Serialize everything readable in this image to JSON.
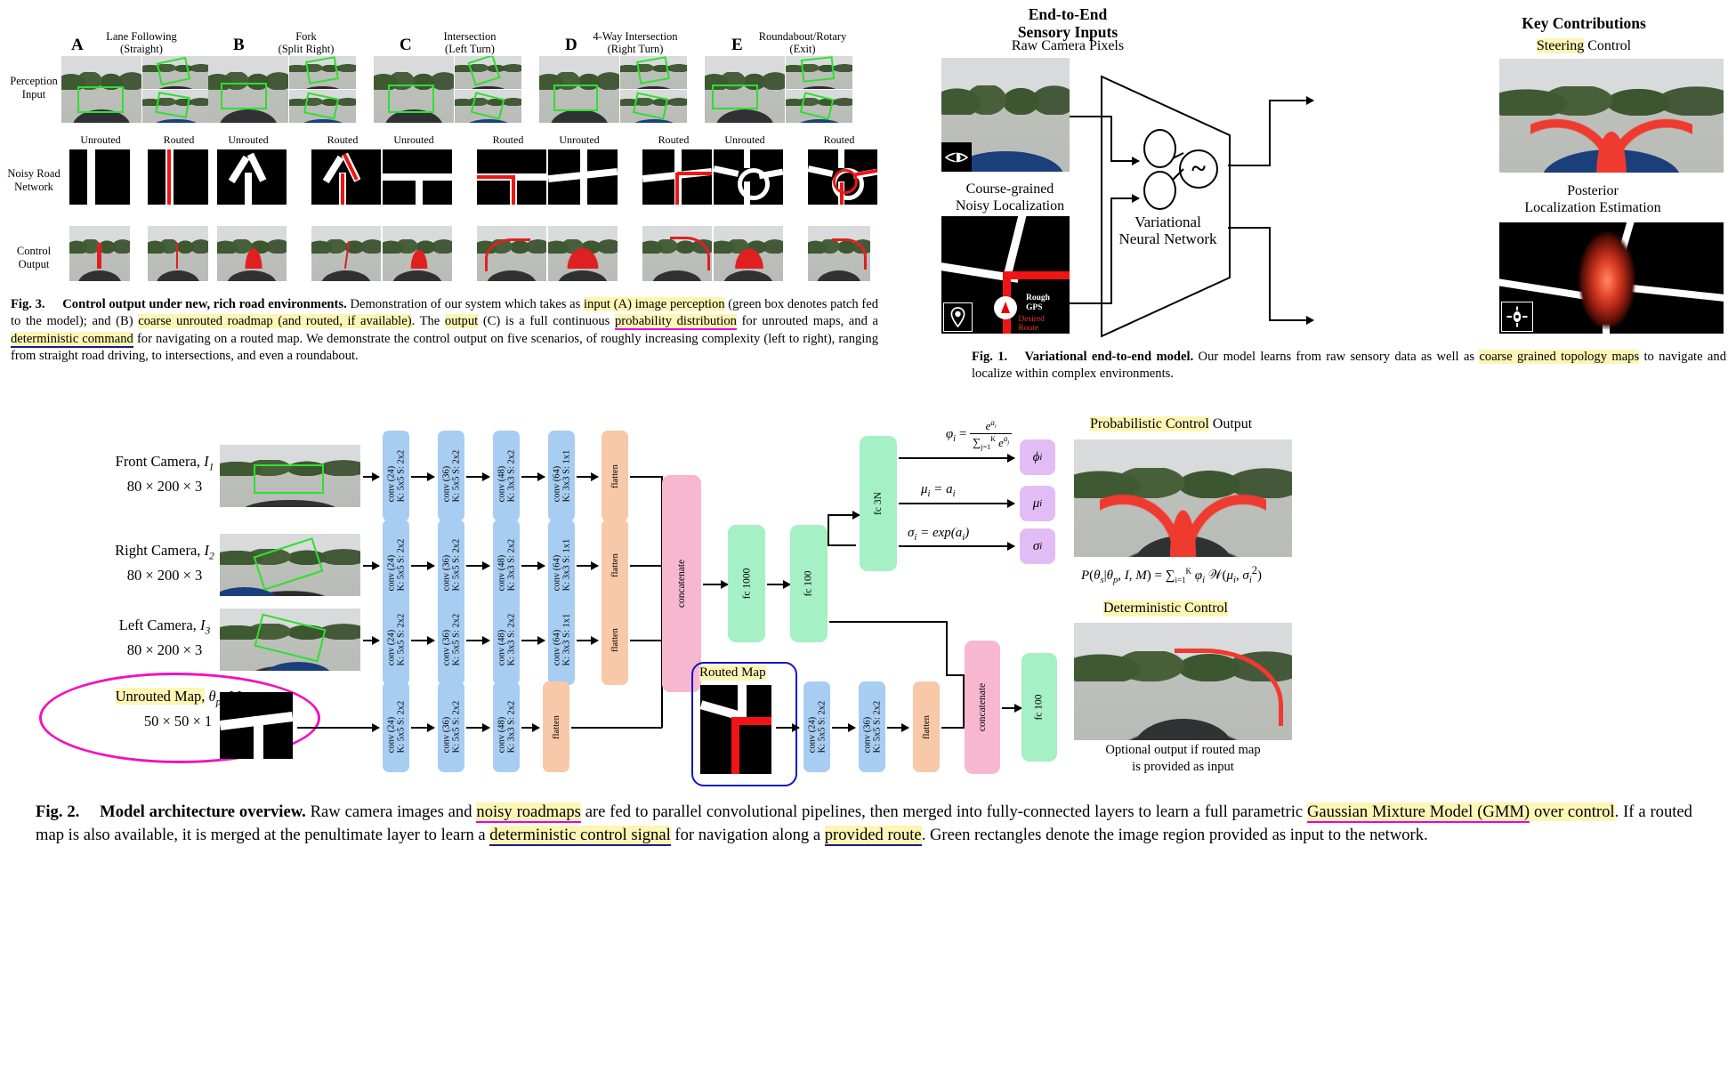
{
  "fig3": {
    "row_labels": [
      "Perception\nInput",
      "Noisy Road\nNetwork",
      "Control\nOutput"
    ],
    "row_label_1a": "Perception",
    "row_label_1b": "Input",
    "row_label_2a": "Noisy Road",
    "row_label_2b": "Network",
    "row_label_3a": "Control",
    "row_label_3b": "Output",
    "scenarios": [
      {
        "letter": "A",
        "title": "Lane Following",
        "subtitle": "(Straight)"
      },
      {
        "letter": "B",
        "title": "Fork",
        "subtitle": "(Split Right)"
      },
      {
        "letter": "C",
        "title": "Intersection",
        "subtitle": "(Left Turn)"
      },
      {
        "letter": "D",
        "title": "4-Way Intersection",
        "subtitle": "(Right Turn)"
      },
      {
        "letter": "E",
        "title": "Roundabout/Rotary",
        "subtitle": "(Exit)"
      }
    ],
    "map_col_labels": [
      "Unrouted",
      "Routed"
    ],
    "caption": {
      "figno": "Fig. 3.",
      "title": "Control output under new, rich road environments.",
      "t1": " Demonstration of our system which takes as ",
      "h1": "input (A) image perception",
      "t2": " (green box denotes patch fed to the model); and (B) ",
      "h2": "coarse unrouted roadmap (and routed, if available)",
      "t3": ". The ",
      "h3": "output",
      "t4": " (C) is a full continuous ",
      "h4": "probability distribution",
      "t5": " for unrouted maps, and a ",
      "h5": "deterministic command",
      "t6": " for navigating on a routed map. We demonstrate the control output on five scenarios, of roughly increasing complexity (left to right), ranging from straight road driving, to intersections, and even a roundabout."
    }
  },
  "fig1": {
    "header_left_1": "End-to-End",
    "header_left_2": "Sensory Inputs",
    "header_right": "Key Contributions",
    "input_1": "Raw Camera Pixels",
    "input_2a": "Course-grained",
    "input_2b": "Noisy Localization",
    "output_1_hl": "Steering",
    "output_1_rest": " Control",
    "output_2a": "Posterior",
    "output_2b": "Localization Estimation",
    "network_1": "Variational",
    "network_2": "Neural Network",
    "network_symbol": "~",
    "map_annot_1a": "Rough",
    "map_annot_1b": "GPS",
    "map_annot_2a": "Desired",
    "map_annot_2b": "Route",
    "icon_eye": "eye-icon",
    "icon_pin": "location-pin-icon",
    "icon_target": "crosshair-target-icon",
    "caption": {
      "figno": "Fig. 1.",
      "title": "Variational end-to-end model.",
      "t1": " Our model learns from raw sensory data as well as ",
      "h1": "coarse grained topology maps",
      "t2": " to navigate and localize within complex environments."
    }
  },
  "fig2": {
    "cameras": [
      {
        "name": "Front Camera,",
        "sym": "I",
        "idx": "1",
        "dims": "80 × 200 × 3"
      },
      {
        "name": "Right Camera,",
        "sym": "I",
        "idx": "2",
        "dims": "80 × 200 × 3"
      },
      {
        "name": "Left Camera,",
        "sym": "I",
        "idx": "3",
        "dims": "80 × 200 × 3"
      }
    ],
    "map_input": {
      "label": "Unrouted Map,",
      "sym": "θ",
      "sub": "p",
      "sym2": ", M",
      "dims": "50 × 50 × 1"
    },
    "conv_camera": [
      {
        "l1": "conv (24)",
        "l2": "K: 5x5 S: 2x2"
      },
      {
        "l1": "conv (36)",
        "l2": "K: 5x5 S: 2x2"
      },
      {
        "l1": "conv (48)",
        "l2": "K: 3x3 S: 2x2"
      },
      {
        "l1": "conv (64)",
        "l2": "K: 3x3 S: 1x1"
      }
    ],
    "conv_map": [
      {
        "l1": "conv (24)",
        "l2": "K: 5x5 S: 2x2"
      },
      {
        "l1": "conv (36)",
        "l2": "K: 5x5 S: 2x2"
      },
      {
        "l1": "conv (48)",
        "l2": "K: 3x3 S: 2x2"
      }
    ],
    "conv_routed": [
      {
        "l1": "conv (24)",
        "l2": "K: 5x5 S: 2x2"
      },
      {
        "l1": "conv (36)",
        "l2": "K: 5x5 S: 2x2"
      }
    ],
    "flatten_label": "flatten",
    "concat_label": "concatenate",
    "fc1000_label": "fc 1000",
    "fc100_label": "fc 100",
    "fc3N_label": "fc 3N",
    "fc100b_label": "fc 100",
    "routed_map_label": "Routed Map",
    "equations": [
      "ϕᵢ = e^{aᵢ} / ∑ⱼ₌₁^K e^{aⱼ}",
      "μᵢ = aᵢ",
      "σᵢ = exp(aᵢ)"
    ],
    "eq_phi_num": "e",
    "eq_phi_den": "",
    "outputs": [
      "ϕ",
      "μ",
      "σ"
    ],
    "prob_title_hl": "Probabilistic Control",
    "prob_title_rest": " Output",
    "gmm_formula": "P(θₛ|θₚ, I, M) = ∑",
    "det_title": "Deterministic Control",
    "det_note_1": "Optional output if routed map",
    "det_note_2": "is provided as input",
    "caption": {
      "figno": "Fig. 2.",
      "title": "Model architecture overview.",
      "t1": " Raw camera images and ",
      "h1": "noisy roadmaps",
      "t2": " are fed to parallel convolutional pipelines, then merged into fully-connected layers to learn a full parametric ",
      "h2": "Gaussian Mixture Model (GMM)",
      "t3": " over control",
      "t4": ". If a routed map is also available, it is merged at the penultimate layer to learn a ",
      "h3": "deterministic control signal",
      "t5": " for navigation along a ",
      "h4": "provided route",
      "t6": ". Green rectangles denote the image region provided as input to the network."
    }
  },
  "colors": {
    "highlight": "#fdf5b4",
    "magenta": "#e800e8",
    "blue_underline": "#1a1a8c",
    "conv_block": "#a8cdf2",
    "flatten_block": "#f8c9a8",
    "concat_block": "#f7b8cf",
    "fc_block": "#a5f0c4",
    "output_block": "#e2bdf5",
    "green_box": "#2ee02e",
    "route_red": "#f01414"
  }
}
